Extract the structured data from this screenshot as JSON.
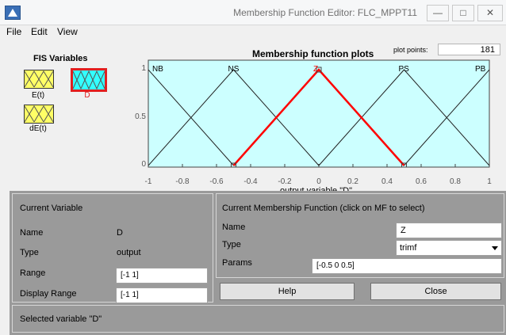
{
  "window": {
    "title": "Membership Function Editor: FLC_MPPT11",
    "minimize_glyph": "—",
    "maximize_glyph": "□",
    "close_glyph": "✕"
  },
  "menu": [
    "File",
    "Edit",
    "View"
  ],
  "fis": {
    "title": "FIS Variables",
    "inputs": [
      "E(t)",
      "dE(t)"
    ],
    "output": "D",
    "selected": "D",
    "colors": {
      "input": "#ffff66",
      "output": "#33ffff",
      "selected_border": "#e02020"
    }
  },
  "plot": {
    "title": "Membership function plots",
    "points_label": "plot points:",
    "points_value": "181",
    "xlabel": "output variable \"D\"",
    "background": "#ccffff",
    "selected_color": "#ff0000"
  },
  "chart_data": {
    "type": "line",
    "title": "Membership function plots",
    "xlabel": "output variable \"D\"",
    "ylabel": "",
    "xlim": [
      -1,
      1
    ],
    "ylim": [
      0,
      1
    ],
    "x_ticks": [
      "-1",
      "-0.8",
      "-0.6",
      "-0.4",
      "-0.2",
      "0",
      "0.2",
      "0.4",
      "0.6",
      "0.8",
      "1"
    ],
    "y_ticks": [
      "0",
      "0.5",
      "1"
    ],
    "series": [
      {
        "name": "NB",
        "x": [
          -1.5,
          -1,
          -0.5
        ],
        "y": [
          0,
          1,
          0
        ]
      },
      {
        "name": "NS",
        "x": [
          -1,
          -0.5,
          0
        ],
        "y": [
          0,
          1,
          0
        ]
      },
      {
        "name": "Z",
        "x": [
          -0.5,
          0,
          0.5
        ],
        "y": [
          0,
          1,
          0
        ],
        "selected": true
      },
      {
        "name": "PS",
        "x": [
          0,
          0.5,
          1
        ],
        "y": [
          0,
          1,
          0
        ]
      },
      {
        "name": "PB",
        "x": [
          0.5,
          1,
          1.5
        ],
        "y": [
          0,
          1,
          0
        ]
      }
    ]
  },
  "current_variable": {
    "title": "Current Variable",
    "name_label": "Name",
    "name_value": "D",
    "type_label": "Type",
    "type_value": "output",
    "range_label": "Range",
    "range_value": "[-1 1]",
    "display_range_label": "Display Range",
    "display_range_value": "[-1 1]"
  },
  "current_mf": {
    "title": "Current Membership Function (click on MF to select)",
    "name_label": "Name",
    "name_value": "Z",
    "type_label": "Type",
    "type_value": "trimf",
    "params_label": "Params",
    "params_value": "[-0.5 0 0.5]"
  },
  "buttons": {
    "help": "Help",
    "close": "Close"
  },
  "status": "Selected variable \"D\""
}
